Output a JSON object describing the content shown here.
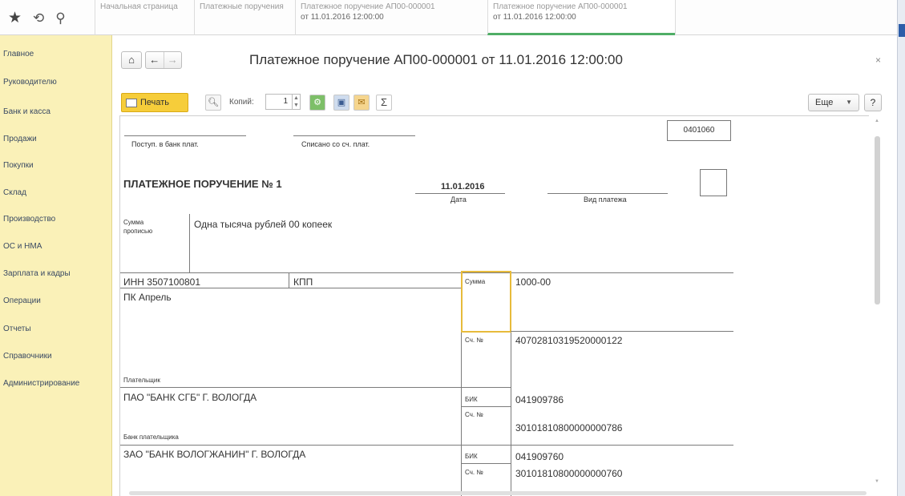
{
  "topbar": {
    "tabs": [
      {
        "line1": "Начальная страница",
        "line2": ""
      },
      {
        "line1": "Платежные поручения",
        "line2": ""
      },
      {
        "line1": "Платежное поручение АП00-000001",
        "line2": "от 11.01.2016 12:00:00"
      },
      {
        "line1": "Платежное поручение АП00-000001",
        "line2": "от 11.01.2016 12:00:00"
      }
    ]
  },
  "sidebar": {
    "items": [
      "Главное",
      "Руководителю",
      "Банк и касса",
      "Продажи",
      "Покупки",
      "Склад",
      "Производство",
      "ОС и НМА",
      "Зарплата и кадры",
      "Операции",
      "Отчеты",
      "Справочники",
      "Администрирование"
    ]
  },
  "header": {
    "title": "Платежное поручение АП00-000001 от 11.01.2016 12:00:00",
    "back": "←",
    "forward": "→",
    "home": "⌂",
    "close": "×"
  },
  "toolbar": {
    "print_label": "Печать",
    "copies_label": "Копий:",
    "copies_value": "1",
    "sigma": "Σ",
    "more_label": "Еще",
    "help_label": "?"
  },
  "document": {
    "form_code": "0401060",
    "received_label": "Поступ. в банк плат.",
    "debited_label": "Списано со сч. плат.",
    "heading": "ПЛАТЕЖНОЕ ПОРУЧЕНИЕ № 1",
    "date_value": "11.01.2016",
    "date_label": "Дата",
    "payment_type_label": "Вид платежа",
    "sum_words_label_1": "Сумма",
    "sum_words_label_2": "прописью",
    "sum_words": "Одна тысяча рублей 00 копеек",
    "inn": "ИНН 3507100801",
    "kpp": "КПП",
    "sum_label": "Сумма",
    "sum_value": "1000-00",
    "payer_name": "ПК Апрель",
    "account_label": "Сч. №",
    "payer_account": "40702810319520000122",
    "payer_label": "Плательщик",
    "payer_bank": "ПАО \"БАНК СГБ\" Г. ВОЛОГДА",
    "bik_label": "БИК",
    "payer_bank_bik": "041909786",
    "payer_bank_account": "30101810800000000786",
    "payer_bank_label": "Банк плательщика",
    "payee_bank": "ЗАО \"БАНК ВОЛОГЖАНИН\" Г. ВОЛОГДА",
    "payee_bank_bik": "041909760",
    "payee_bank_account": "30101810800000000760"
  }
}
